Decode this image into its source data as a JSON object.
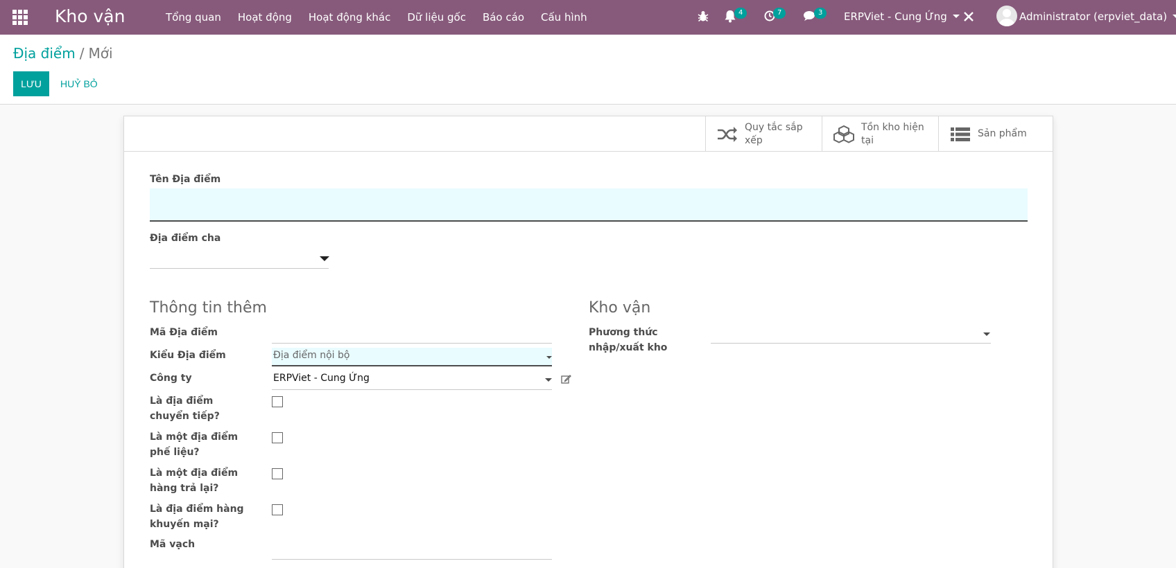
{
  "navbar": {
    "brand": "Kho vận",
    "menu": [
      "Tổng quan",
      "Hoạt động",
      "Hoạt động khác",
      "Dữ liệu gốc",
      "Báo cáo",
      "Cấu hình"
    ],
    "notifications_count": "4",
    "activities_count": "7",
    "messages_count": "3",
    "company": "ERPViet - Cung Ứng",
    "user": "Administrator (erpviet_data)"
  },
  "breadcrumb": {
    "parent": "Địa điểm",
    "separator": "/",
    "current": "Mới"
  },
  "actions": {
    "save": "LƯU",
    "discard": "HUỶ BỎ"
  },
  "stat_buttons": [
    {
      "label": "Quy tắc sắp xếp",
      "icon": "shuffle-icon"
    },
    {
      "label": "Tồn kho hiện tại",
      "icon": "cubes-icon"
    },
    {
      "label": "Sản phẩm",
      "icon": "list-icon"
    }
  ],
  "form": {
    "name_label": "Tên Địa điểm",
    "name_value": "",
    "parent_label": "Địa điểm cha",
    "parent_value": "",
    "section_info": "Thông tin thêm",
    "section_logistics": "Kho vận",
    "code_label": "Mã Địa điểm",
    "code_value": "",
    "type_label": "Kiểu Địa điểm",
    "type_value": "Địa điểm nội bộ",
    "company_label": "Công ty",
    "company_value": "ERPViet - Cung Ứng",
    "transit_label": "Là địa điểm chuyển tiếp?",
    "scrap_label": "Là một địa điểm phế liệu?",
    "return_label": "Là một địa điểm hàng trả lại?",
    "promo_label": "Là địa điểm hàng khuyến mại?",
    "barcode_label": "Mã vạch",
    "barcode_value": "",
    "removal_label": "Phương thức nhập/xuất kho",
    "removal_value": ""
  },
  "colors": {
    "navbar": "#875a7b",
    "accent": "#00a09d",
    "required_field_bg": "#e9fcff"
  }
}
